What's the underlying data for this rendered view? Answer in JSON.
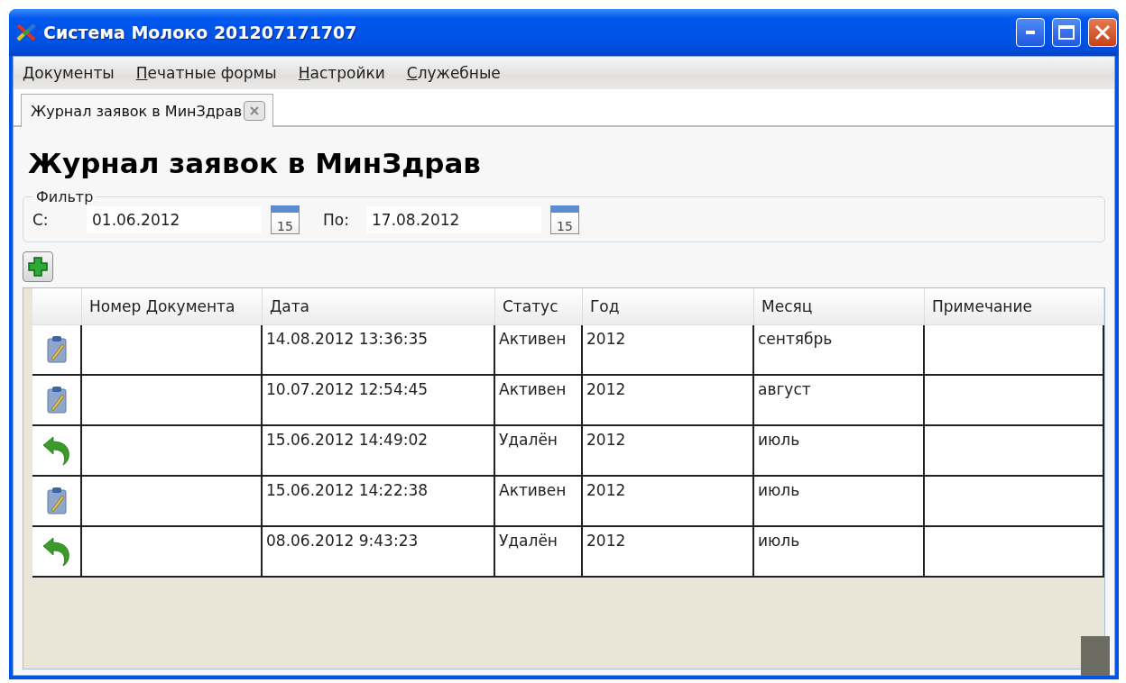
{
  "window": {
    "title": "Система Молоко 201207171707"
  },
  "menu": [
    "Документы",
    "Печатные формы",
    "Настройки",
    "Служебные"
  ],
  "tabs": [
    {
      "label": "Журнал заявок в МинЗдрав",
      "selected": true
    }
  ],
  "heading": "Журнал заявок в МинЗдрав",
  "filter": {
    "legend": "Фильтр",
    "from_label": "С:",
    "from_value": "01.06.2012",
    "to_label": "По:",
    "to_value": "17.08.2012",
    "from_calendar_day": "15",
    "to_calendar_day": "15"
  },
  "table": {
    "columns": [
      "Номер Документа",
      "Дата",
      "Статус",
      "Год",
      "Месяц",
      "Примечание"
    ],
    "rows": [
      {
        "kind": "edit",
        "cells": [
          "",
          "14.08.2012 13:36:35",
          "Активен",
          "2012",
          "сентябрь",
          ""
        ]
      },
      {
        "kind": "edit",
        "cells": [
          "",
          "10.07.2012 12:54:45",
          "Активен",
          "2012",
          "август",
          ""
        ]
      },
      {
        "kind": "restore",
        "cells": [
          "",
          "15.06.2012 14:49:02",
          "Удалён",
          "2012",
          "июль",
          ""
        ]
      },
      {
        "kind": "edit",
        "cells": [
          "",
          "15.06.2012 14:22:38",
          "Активен",
          "2012",
          "июль",
          ""
        ]
      },
      {
        "kind": "restore",
        "cells": [
          "",
          "08.06.2012 9:43:23",
          "Удалён",
          "2012",
          "июль",
          ""
        ]
      }
    ]
  }
}
